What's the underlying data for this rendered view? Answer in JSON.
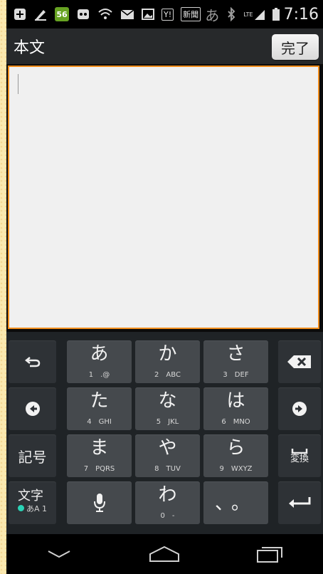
{
  "status_bar": {
    "badge": "56",
    "yahoo": "Y!",
    "news": "新聞",
    "ime": "あ",
    "network": "LTE",
    "time": "7:16"
  },
  "title_bar": {
    "title": "本文",
    "done_label": "完了"
  },
  "editor": {
    "value": ""
  },
  "keyboard": {
    "keys": [
      {
        "kana": "あ",
        "num": "1",
        "sub": ".@"
      },
      {
        "kana": "か",
        "num": "2",
        "sub": "ABC"
      },
      {
        "kana": "さ",
        "num": "3",
        "sub": "DEF"
      },
      {
        "kana": "た",
        "num": "4",
        "sub": "GHI"
      },
      {
        "kana": "な",
        "num": "5",
        "sub": "JKL"
      },
      {
        "kana": "は",
        "num": "6",
        "sub": "MNO"
      },
      {
        "kana": "ま",
        "num": "7",
        "sub": "PQRS"
      },
      {
        "kana": "や",
        "num": "8",
        "sub": "TUV"
      },
      {
        "kana": "ら",
        "num": "9",
        "sub": "WXYZ"
      },
      {
        "kana": "わ",
        "num": "0",
        "sub": "-"
      },
      {
        "kana": "、。",
        "num": "",
        "sub": ""
      }
    ],
    "kigou_label": "記号",
    "henkan_label": "変換",
    "moji_label": "文字",
    "moji_sub": "A 1",
    "moji_sub_kana": "あ"
  },
  "colors": {
    "accent": "#f08c1a",
    "key": "#45494d",
    "keyboard_bg": "#1f2326"
  }
}
